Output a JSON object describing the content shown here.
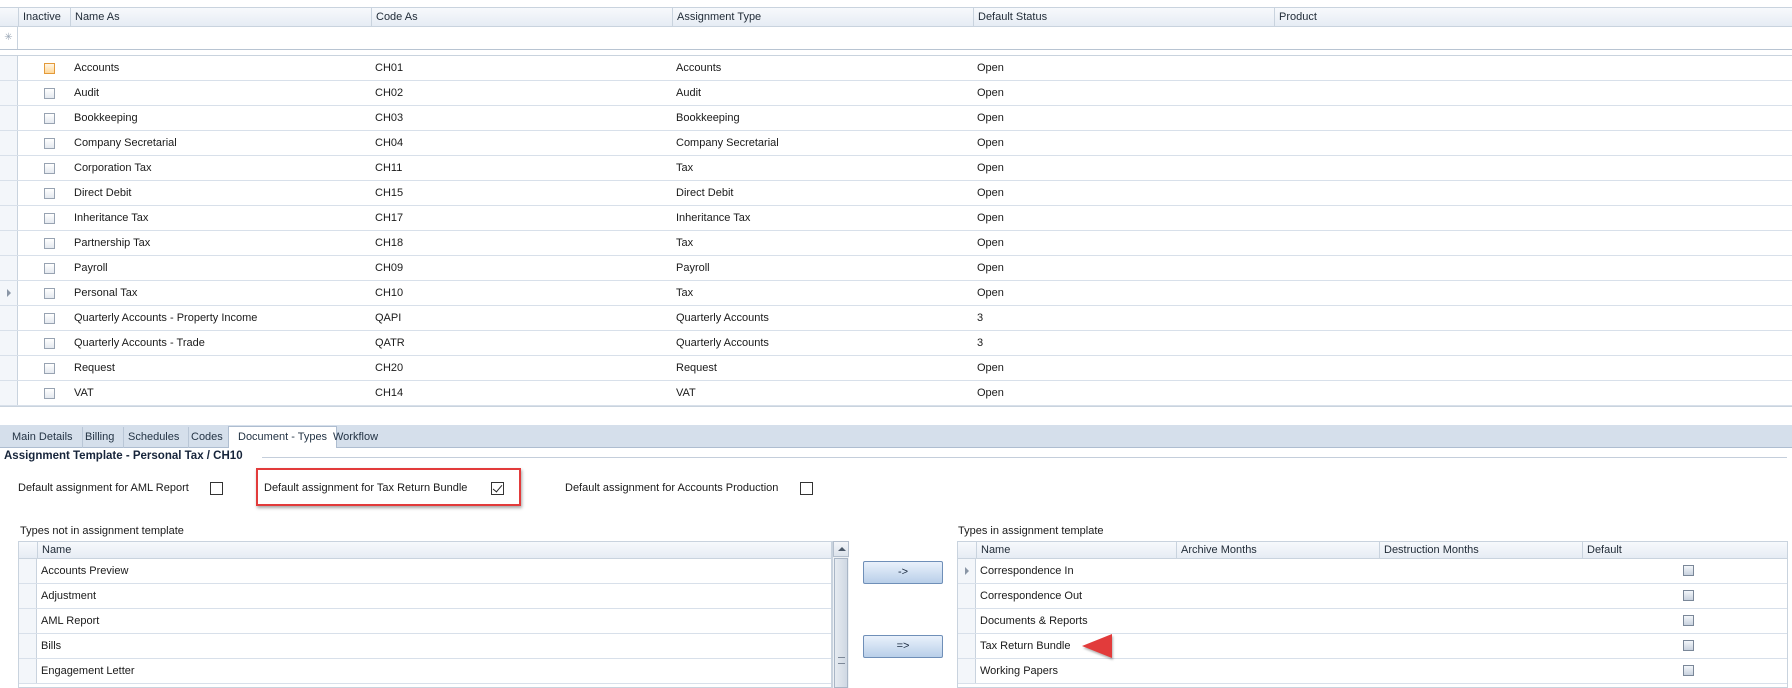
{
  "grid": {
    "columns": [
      "Inactive",
      "Name As",
      "Code As",
      "Assignment Type",
      "Default Status",
      "Product"
    ],
    "rows": [
      {
        "name": "Accounts",
        "code": "CH01",
        "type": "Accounts",
        "status": "Open"
      },
      {
        "name": "Audit",
        "code": "CH02",
        "type": "Audit",
        "status": "Open"
      },
      {
        "name": "Bookkeeping",
        "code": "CH03",
        "type": "Bookkeeping",
        "status": "Open"
      },
      {
        "name": "Company Secretarial",
        "code": "CH04",
        "type": "Company Secretarial",
        "status": "Open"
      },
      {
        "name": "Corporation Tax",
        "code": "CH11",
        "type": "Tax",
        "status": "Open"
      },
      {
        "name": "Direct Debit",
        "code": "CH15",
        "type": "Direct Debit",
        "status": "Open"
      },
      {
        "name": "Inheritance Tax",
        "code": "CH17",
        "type": "Inheritance Tax",
        "status": "Open"
      },
      {
        "name": "Partnership Tax",
        "code": "CH18",
        "type": "Tax",
        "status": "Open"
      },
      {
        "name": "Payroll",
        "code": "CH09",
        "type": "Payroll",
        "status": "Open"
      },
      {
        "name": "Personal Tax",
        "code": "CH10",
        "type": "Tax",
        "status": "Open"
      },
      {
        "name": "Quarterly Accounts - Property Income",
        "code": "QAPI",
        "type": "Quarterly Accounts",
        "status": "3"
      },
      {
        "name": "Quarterly Accounts - Trade",
        "code": "QATR",
        "type": "Quarterly Accounts",
        "status": "3"
      },
      {
        "name": "Request",
        "code": "CH20",
        "type": "Request",
        "status": "Open"
      },
      {
        "name": "VAT",
        "code": "CH14",
        "type": "VAT",
        "status": "Open"
      }
    ]
  },
  "tabs": [
    "Main Details",
    "Billing",
    "Schedules",
    "Codes",
    "Document - Types",
    "Workflow"
  ],
  "detail": {
    "title": "Assignment Template - Personal Tax / CH10",
    "options": {
      "aml_label": "Default assignment for AML Report",
      "aml_checked": false,
      "tax_return_label": "Default assignment for Tax Return Bundle",
      "tax_return_checked": true,
      "accounts_production_label": "Default assignment for Accounts Production",
      "accounts_production_checked": false
    },
    "left_list": {
      "title": "Types not in assignment template",
      "header": "Name",
      "items": [
        "Accounts Preview",
        "Adjustment",
        "AML Report",
        "Bills",
        "Engagement Letter"
      ]
    },
    "buttons": {
      "move_one": "->",
      "move_all": "=>"
    },
    "right_list": {
      "title": "Types in assignment template",
      "headers": [
        "Name",
        "Archive Months",
        "Destruction Months",
        "Default"
      ],
      "items": [
        "Correspondence In",
        "Correspondence Out",
        "Documents & Reports",
        "Tax Return Bundle",
        "Working Papers"
      ]
    }
  },
  "colors": {
    "highlight": "#e23b3b",
    "tab_bar": "#d5dfeb",
    "grid_line": "#c9d3de"
  }
}
